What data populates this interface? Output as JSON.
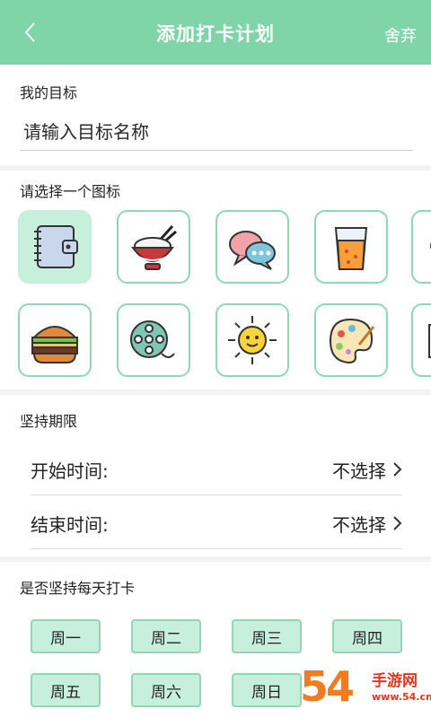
{
  "header": {
    "back_icon": "chevron-left-icon",
    "title": "添加打卡计划",
    "discard_label": "舍弃"
  },
  "goal": {
    "label": "我的目标",
    "placeholder": "请输入目标名称",
    "value": ""
  },
  "icons": {
    "label": "请选择一个图标",
    "items": [
      "notebook-icon",
      "rice-bowl-icon",
      "chat-bubbles-icon",
      "juice-cup-icon",
      "cup-icon",
      "burger-icon",
      "film-reel-icon",
      "sun-icon",
      "paint-palette-icon",
      "book-icon"
    ],
    "selected": "notebook-icon"
  },
  "duration": {
    "label": "坚持期限",
    "start_label": "开始时间:",
    "start_value": "不选择",
    "end_label": "结束时间:",
    "end_value": "不选择"
  },
  "daily": {
    "label": "是否坚持每天打卡",
    "days": [
      "周一",
      "周二",
      "周三",
      "周四",
      "周五",
      "周六",
      "周日"
    ]
  },
  "watermark": {
    "number": "54",
    "text": "手游网",
    "url": "www.54.cn"
  },
  "colors": {
    "header": "#7fd5a8",
    "accent_border": "#8fd8b4",
    "selected_bg": "#c7f0dc"
  }
}
